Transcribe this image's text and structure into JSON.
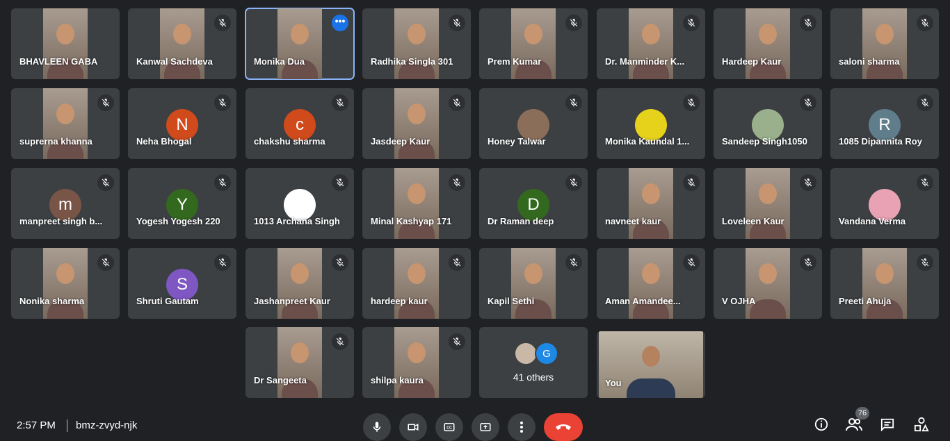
{
  "participants": [
    {
      "name": "BHAVLEEN GABA",
      "type": "video",
      "muted": false
    },
    {
      "name": "Kanwal Sachdeva",
      "type": "video",
      "muted": true
    },
    {
      "name": "Monika Dua",
      "type": "video",
      "muted": false,
      "active": true
    },
    {
      "name": "Radhika Singla 301",
      "type": "video",
      "muted": true
    },
    {
      "name": "Prem Kumar",
      "type": "video",
      "muted": true
    },
    {
      "name": "Dr. Manminder K...",
      "type": "video",
      "muted": true
    },
    {
      "name": "Hardeep Kaur",
      "type": "video",
      "muted": true
    },
    {
      "name": "saloni sharma",
      "type": "video",
      "muted": true
    },
    {
      "name": "suprerna khanna",
      "type": "video",
      "muted": true
    },
    {
      "name": "Neha Bhogal",
      "type": "avatar",
      "initial": "N",
      "color": "#d04a1b",
      "muted": true
    },
    {
      "name": "chakshu sharma",
      "type": "avatar",
      "initial": "c",
      "color": "#d04a1b",
      "muted": true
    },
    {
      "name": "Jasdeep Kaur",
      "type": "video",
      "muted": true
    },
    {
      "name": "Honey Talwar",
      "type": "avatar",
      "initial": "",
      "color": "#8a6e5a",
      "muted": true
    },
    {
      "name": "Monika Kaundal 1...",
      "type": "avatar",
      "initial": "",
      "color": "#e6d21a",
      "muted": true
    },
    {
      "name": "Sandeep Singh1050",
      "type": "avatar",
      "initial": "",
      "color": "#9ab08c",
      "muted": true
    },
    {
      "name": "1085 Dipannita Roy",
      "type": "avatar",
      "initial": "R",
      "color": "#607d8b",
      "muted": true
    },
    {
      "name": "manpreet singh b...",
      "type": "avatar",
      "initial": "m",
      "color": "#795548",
      "muted": true
    },
    {
      "name": "Yogesh Yogesh 220",
      "type": "avatar",
      "initial": "Y",
      "color": "#33691e",
      "muted": true
    },
    {
      "name": "1013 Archana Singh",
      "type": "avatar",
      "initial": "",
      "color": "#ffffff",
      "muted": true
    },
    {
      "name": "Minal Kashyap 171",
      "type": "video",
      "muted": true
    },
    {
      "name": "Dr Raman deep",
      "type": "avatar",
      "initial": "D",
      "color": "#33691e",
      "muted": true
    },
    {
      "name": "navneet kaur",
      "type": "video",
      "muted": true
    },
    {
      "name": "Loveleen Kaur",
      "type": "video",
      "muted": true
    },
    {
      "name": "Vandana Verma",
      "type": "avatar",
      "initial": "",
      "color": "#e9a2b3",
      "muted": true
    },
    {
      "name": "Nonika sharma",
      "type": "video",
      "muted": true
    },
    {
      "name": "Shruti Gautam",
      "type": "avatar",
      "initial": "S",
      "color": "#7e57c2",
      "muted": true
    },
    {
      "name": "Jashanpreet Kaur",
      "type": "video",
      "muted": true
    },
    {
      "name": "hardeep kaur",
      "type": "video",
      "muted": true
    },
    {
      "name": "Kapil Sethi",
      "type": "video",
      "muted": true
    },
    {
      "name": "Aman Amandee...",
      "type": "video",
      "muted": true
    },
    {
      "name": "V OJHA",
      "type": "video",
      "muted": true
    },
    {
      "name": "Preeti Ahuja",
      "type": "video",
      "muted": true
    },
    {
      "name": "Dr Sangeeta",
      "type": "video",
      "muted": true
    },
    {
      "name": "shilpa kaura",
      "type": "video",
      "muted": true
    }
  ],
  "others": {
    "label": "41 others",
    "initial": "G"
  },
  "self": {
    "name": "You"
  },
  "meeting": {
    "time": "2:57 PM",
    "code": "bmz-zvyd-njk"
  },
  "controls": {
    "participant_count": "76",
    "accent_red": "#ea4335",
    "icons": [
      "mic-icon",
      "camera-icon",
      "captions-icon",
      "present-icon",
      "more-options-icon",
      "hang-up-icon",
      "info-icon",
      "people-icon",
      "chat-icon",
      "activities-icon"
    ]
  }
}
